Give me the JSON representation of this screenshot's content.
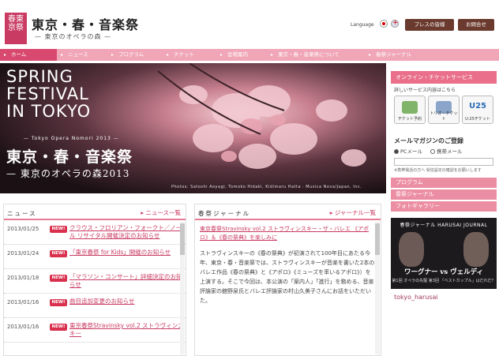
{
  "header": {
    "seal": "春東京祭",
    "title": "東京・春・音楽祭",
    "subtitle": "— 東京のオペラの森 —",
    "language_label": "Language",
    "press_button": "プレスの皆様",
    "contact_button": "お問合せ"
  },
  "nav": [
    {
      "label": "ホーム",
      "active": true
    },
    {
      "label": "ニュース",
      "active": false
    },
    {
      "label": "プログラム",
      "active": false
    },
    {
      "label": "チケット",
      "active": false
    },
    {
      "label": "会場案内",
      "active": false
    },
    {
      "label": "東京・春・音楽祭について",
      "active": false
    },
    {
      "label": "春祭ジャーナル",
      "active": false
    }
  ],
  "hero": {
    "title_en": "SPRING\nFESTIVAL\nIN TOKYO",
    "tagline": "— Tokyo Opera Nomori 2013 —",
    "title_jp": "東京・春・音楽祭",
    "subtitle_jp": "— 東京のオペラの森2013",
    "credit": "Photos: Satoshi Aoyagi, Tomoko Hidaki, Kidimaru Hatta · Musica Nova/Japan, Inc."
  },
  "sidebar": {
    "ticket_header": "オンライン・チケットサービス",
    "ticket_note": "詳しいサービス内容はこちら",
    "tickets": [
      {
        "label": "チケット予約",
        "icon": "ticket-icon"
      },
      {
        "label": "トリオ・チケット",
        "icon": "trio-icon"
      },
      {
        "label": "U-25チケット",
        "icon": "u25-icon",
        "mark": "U25"
      }
    ],
    "mail_header": "メールマガジンのご登録",
    "mail_options": [
      "PCメール",
      "携帯メール"
    ],
    "mail_note": "※携帯電話の方へ 受信設定の確認をお願いします",
    "links": [
      "プログラム",
      "春祭ジャーナル",
      "フォトギャラリー"
    ],
    "banner_title": "春祭ジャーナル HARUSAI JOURNAL",
    "banner_names": "ワーグナー vs ヴェルディ",
    "banner_caption": "第1回 オペラの先駆 第3回 「ベストカップル」はだれだ？",
    "tokyo_haru": "tokyo_harusai"
  },
  "news": {
    "title": "ニュース",
    "more": "ニュース一覧",
    "badge": "NEW!",
    "items": [
      {
        "date": "2013/01/25",
        "text": "クラウス・フロリアン・フォークト／ノール リサイタル開催決定のお知らせ"
      },
      {
        "date": "2013/01/24",
        "text": "「東京春祭 for Kids」開催のお知らせ"
      },
      {
        "date": "2013/01/18",
        "text": "「マラソン・コンサート」詳細決定のお知らせ"
      },
      {
        "date": "2013/01/16",
        "text": "曲目追加変更のお知らせ"
      },
      {
        "date": "2013/01/16",
        "text": "東京春祭Stravinsky vol.2 ストラヴィンスキー"
      }
    ]
  },
  "journal": {
    "title": "春祭ジャーナル",
    "more": "ジャーナル一覧",
    "subject": "東京春祭Stravinsky vol.2 ストラヴィンスキー・ザ・バレエ 《アポロ》＆《春の祭典》を楽しみに",
    "body": "ストラヴィンスキーの《春の祭典》が初演されて100年目にあたる今年、東京・春・音楽祭では、ストラヴィンスキーが音楽を書いた2本のバレエ作品《春の祭典》と《アポロ》《ミューズを率いるアポロ》）を上演する。そこで今回は、本公演の「案内人」「進行」を務める、音楽評論家の舘野泉氏とバレエ評論家の村山久美子さんにお話をいただいた。"
  },
  "colors": {
    "accent": "#d9486e",
    "nav": "#f0a6b6",
    "sidebar_bar": "#e96f8a",
    "button_brown": "#6b3a2e",
    "badge": "#d9304e"
  }
}
